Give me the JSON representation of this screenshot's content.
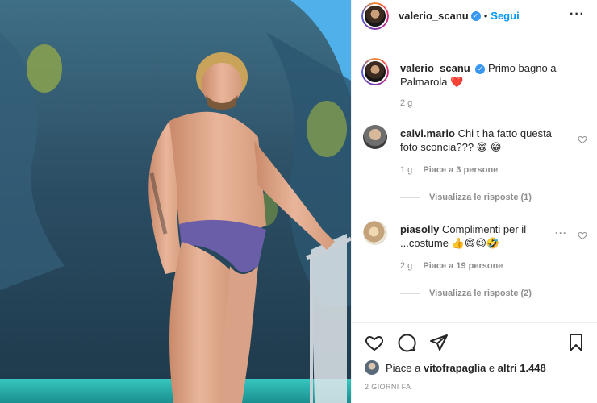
{
  "post": {
    "author": "valerio_scanu",
    "verified": true,
    "follow_label": "Segui",
    "separator": "•",
    "caption_author": "valerio_scanu",
    "caption_text": "Primo bagno a Palmarola",
    "caption_emoji": "❤️",
    "caption_time": "2 g"
  },
  "comments": [
    {
      "user": "calvi.mario",
      "text": "Chi t ha fatto questa foto sconcia??? 😁 😁",
      "time": "1 g",
      "likes": "Piace a 3 persone",
      "replies": "Visualizza le risposte (1)"
    },
    {
      "user": "piasolly",
      "text": "Complimenti per il ...costume 👍😄😉🤣",
      "time": "2 g",
      "likes": "Piace a 19 persone",
      "replies": "Visualizza le risposte (2)"
    }
  ],
  "footer": {
    "likes_prefix": "Piace a",
    "likes_user": "vitofrapaglia",
    "likes_joiner": "e",
    "likes_others": "altri 1.448",
    "date": "2 GIORNI FA"
  },
  "colors": {
    "accent": "#0095f6",
    "verified": "#3897f0",
    "meta": "#8e8e8e"
  },
  "icons": [
    "heart-icon",
    "comment-icon",
    "share-icon",
    "bookmark-icon",
    "more-icon",
    "verified-icon"
  ]
}
